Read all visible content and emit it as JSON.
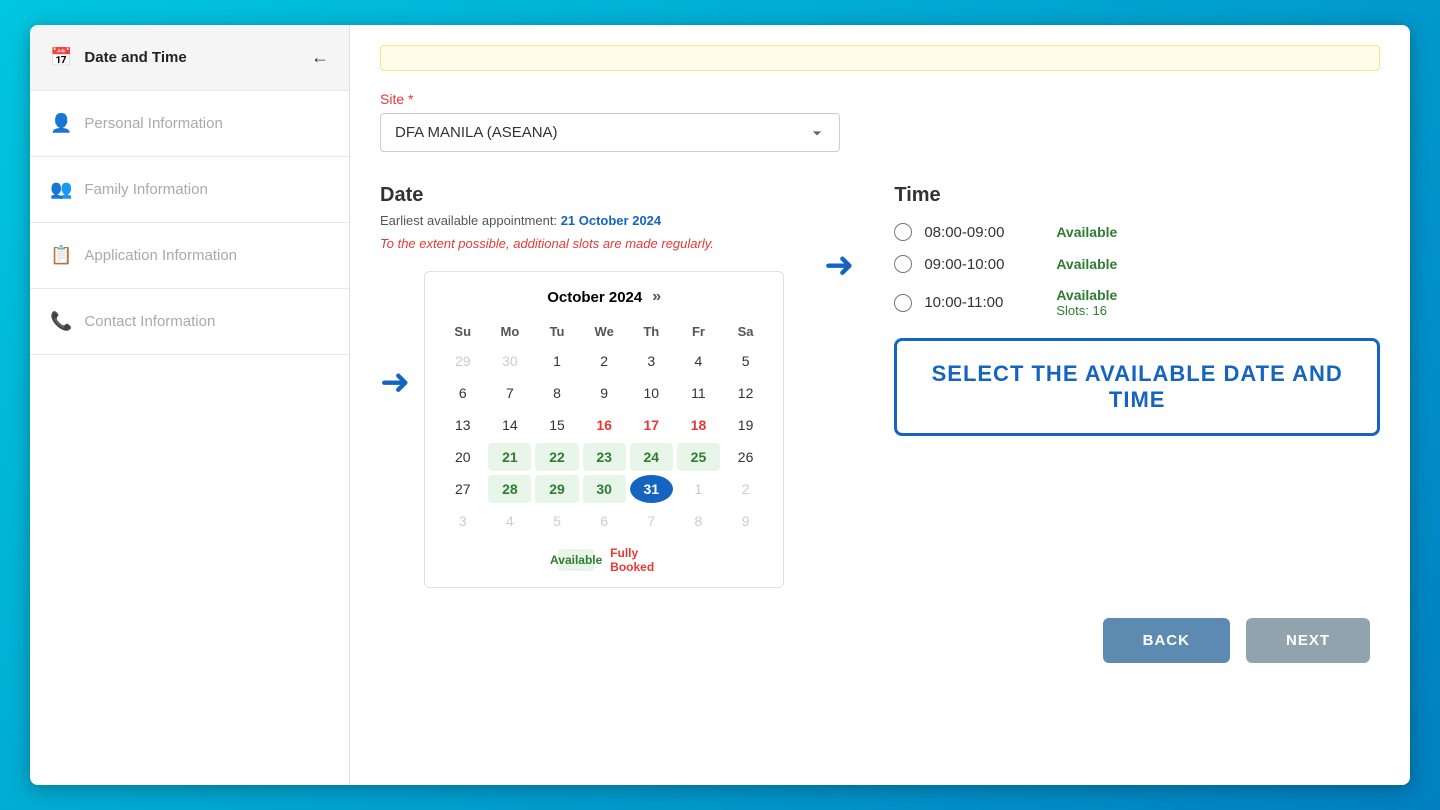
{
  "sidebar": {
    "items": [
      {
        "id": "date-time",
        "label": "Date and Time",
        "icon": "📅",
        "active": true,
        "hasArrow": true
      },
      {
        "id": "personal-info",
        "label": "Personal Information",
        "icon": "👤",
        "active": false
      },
      {
        "id": "family-info",
        "label": "Family Information",
        "icon": "👥",
        "active": false
      },
      {
        "id": "application-info",
        "label": "Application Information",
        "icon": "📋",
        "active": false
      },
      {
        "id": "contact-info",
        "label": "Contact Information",
        "icon": "📞",
        "active": false
      }
    ]
  },
  "main": {
    "top_bar_text": "",
    "site_label": "Site",
    "site_required": "*",
    "site_selected": "DFA MANILA (ASEANA)",
    "date_heading": "Date",
    "earliest_label": "Earliest available appointment:",
    "earliest_date": "21 October 2024",
    "additional_slots_text": "To the extent possible, additional slots are made regularly.",
    "calendar": {
      "month_year": "October 2024",
      "nav_next": "»",
      "day_headers": [
        "Su",
        "Mo",
        "Tu",
        "We",
        "Th",
        "Fr",
        "Sa"
      ],
      "weeks": [
        [
          {
            "day": "29",
            "type": "other-month"
          },
          {
            "day": "30",
            "type": "other-month"
          },
          {
            "day": "1",
            "type": "normal"
          },
          {
            "day": "2",
            "type": "normal"
          },
          {
            "day": "3",
            "type": "normal"
          },
          {
            "day": "4",
            "type": "normal"
          },
          {
            "day": "5",
            "type": "normal"
          }
        ],
        [
          {
            "day": "6",
            "type": "normal"
          },
          {
            "day": "7",
            "type": "normal"
          },
          {
            "day": "8",
            "type": "normal"
          },
          {
            "day": "9",
            "type": "normal"
          },
          {
            "day": "10",
            "type": "normal"
          },
          {
            "day": "11",
            "type": "normal"
          },
          {
            "day": "12",
            "type": "normal"
          }
        ],
        [
          {
            "day": "13",
            "type": "normal"
          },
          {
            "day": "14",
            "type": "normal"
          },
          {
            "day": "15",
            "type": "normal"
          },
          {
            "day": "16",
            "type": "fully-booked"
          },
          {
            "day": "17",
            "type": "fully-booked"
          },
          {
            "day": "18",
            "type": "fully-booked"
          },
          {
            "day": "19",
            "type": "normal"
          }
        ],
        [
          {
            "day": "20",
            "type": "normal"
          },
          {
            "day": "21",
            "type": "available"
          },
          {
            "day": "22",
            "type": "available"
          },
          {
            "day": "23",
            "type": "available"
          },
          {
            "day": "24",
            "type": "available"
          },
          {
            "day": "25",
            "type": "available"
          },
          {
            "day": "26",
            "type": "normal"
          }
        ],
        [
          {
            "day": "27",
            "type": "normal"
          },
          {
            "day": "28",
            "type": "available"
          },
          {
            "day": "29",
            "type": "available"
          },
          {
            "day": "30",
            "type": "available"
          },
          {
            "day": "31",
            "type": "selected"
          },
          {
            "day": "1",
            "type": "other-month"
          },
          {
            "day": "2",
            "type": "other-month"
          }
        ],
        [
          {
            "day": "3",
            "type": "other-month"
          },
          {
            "day": "4",
            "type": "other-month"
          },
          {
            "day": "5",
            "type": "other-month"
          },
          {
            "day": "6",
            "type": "other-month"
          },
          {
            "day": "7",
            "type": "other-month"
          },
          {
            "day": "8",
            "type": "other-month"
          },
          {
            "day": "9",
            "type": "other-month"
          }
        ]
      ],
      "legend": {
        "available_label": "Available",
        "fully_booked_label": "Fully Booked"
      }
    },
    "time_heading": "Time",
    "time_slots": [
      {
        "range": "08:00-09:00",
        "status": "Available",
        "slots": null
      },
      {
        "range": "09:00-10:00",
        "status": "Available",
        "slots": null
      },
      {
        "range": "10:00-11:00",
        "status": "Available",
        "slots_label": "Slots: 16"
      }
    ],
    "select_banner": "SELECT THE AVAILABLE DATE  AND TIME",
    "back_btn": "BACK",
    "next_btn": "NEXT"
  }
}
